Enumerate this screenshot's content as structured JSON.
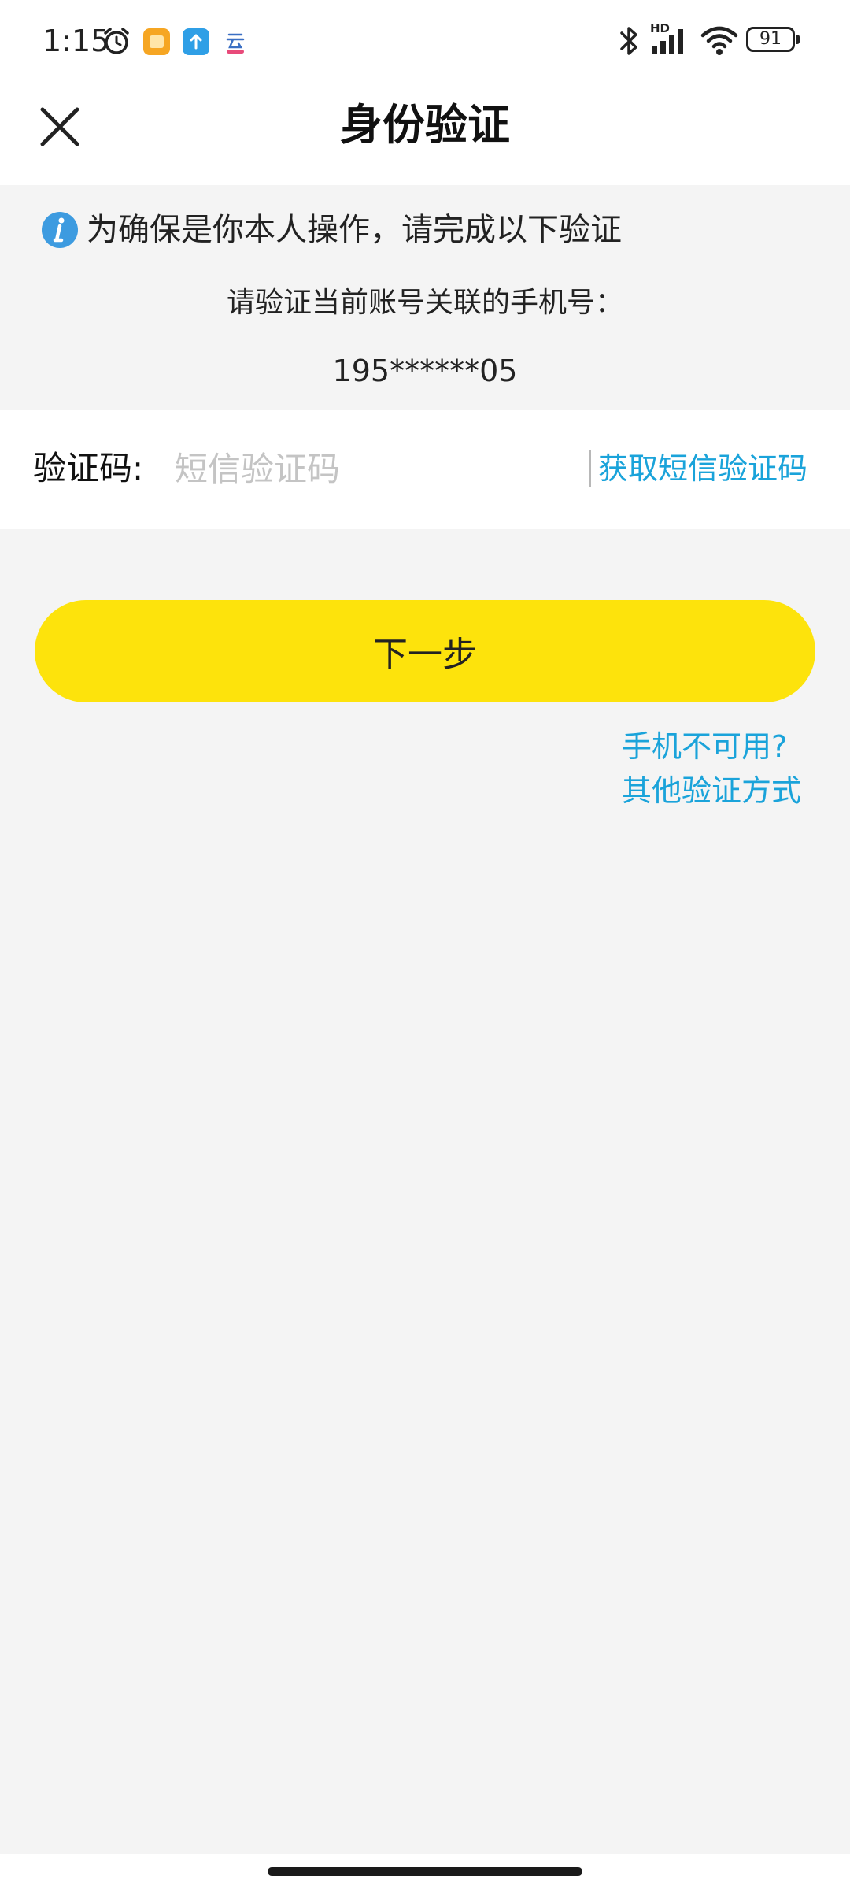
{
  "status_bar": {
    "time": "1:15",
    "battery": "91",
    "network_label": "HD",
    "icons": [
      "alarm-icon",
      "app-notification-orange-icon",
      "upload-icon",
      "cloud-app-icon",
      "bluetooth-icon",
      "signal-icon",
      "wifi-icon",
      "battery-icon"
    ]
  },
  "header": {
    "title": "身份验证",
    "close_icon": "close-icon"
  },
  "info": {
    "notice": "为确保是你本人操作，请完成以下验证",
    "icon": "info-icon",
    "description": "请验证当前账号关联的手机号：",
    "phone": "195******05"
  },
  "code_row": {
    "label": "验证码:",
    "placeholder": "短信验证码",
    "value": "",
    "get_code": "获取短信验证码"
  },
  "actions": {
    "next": "下一步",
    "phone_unavailable": "手机不可用?",
    "other_methods": "其他验证方式"
  },
  "colors": {
    "accent_yellow": "#fde30c",
    "link_blue": "#1aa3da",
    "info_blue": "#3d9be0",
    "background": "#f4f4f4"
  }
}
